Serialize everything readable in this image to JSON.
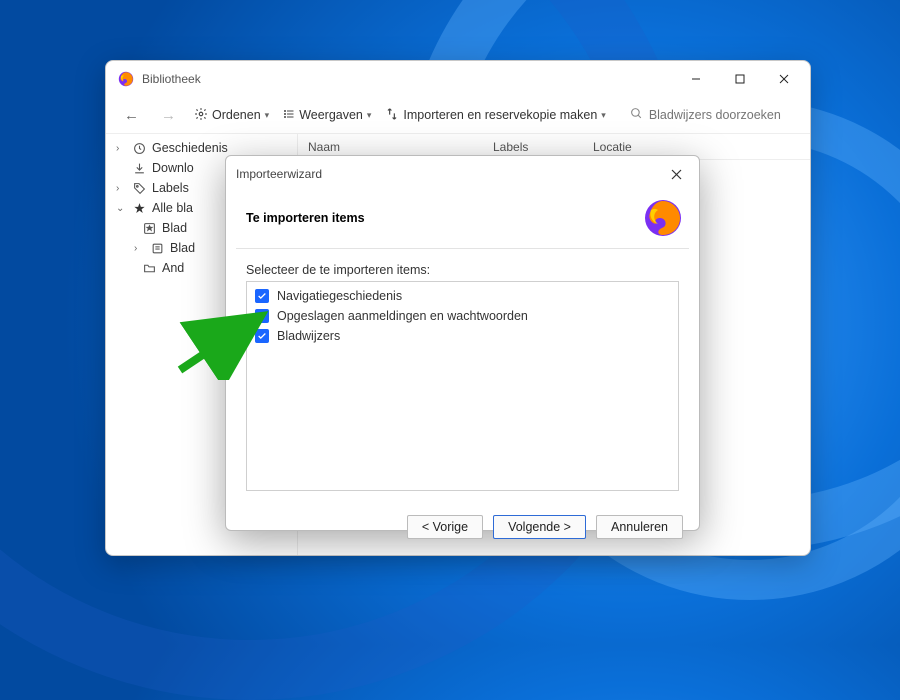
{
  "library": {
    "title": "Bibliotheek",
    "toolbar": {
      "sort_label": "Ordenen",
      "views_label": "Weergaven",
      "import_label": "Importeren en reservekopie maken",
      "search_placeholder": "Bladwijzers doorzoeken"
    },
    "sidebar": {
      "history": "Geschiedenis",
      "downloads": "Downlo",
      "labels": "Labels",
      "allbm": "Alle bla",
      "child_blad1": "Blad",
      "child_blad2": "Blad",
      "child_and": "And"
    },
    "columns": {
      "name": "Naam",
      "labels": "Labels",
      "location": "Locatie"
    }
  },
  "wizard": {
    "window_title": "Importeerwizard",
    "heading": "Te importeren items",
    "prompt": "Selecteer de te importeren items:",
    "items": [
      {
        "label": "Navigatiegeschiedenis",
        "checked": true
      },
      {
        "label": "Opgeslagen aanmeldingen en wachtwoorden",
        "checked": true
      },
      {
        "label": "Bladwijzers",
        "checked": true
      }
    ],
    "buttons": {
      "prev": "< Vorige",
      "next": "Volgende >",
      "cancel": "Annuleren"
    }
  }
}
